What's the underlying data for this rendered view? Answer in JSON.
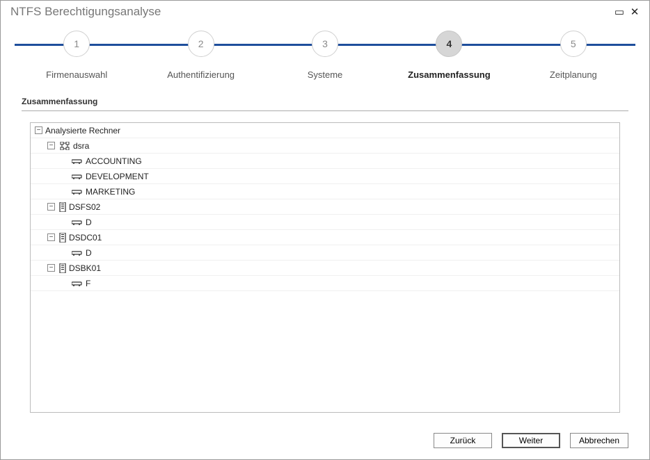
{
  "window": {
    "title": "NTFS Berechtigungsanalyse"
  },
  "stepper": {
    "steps": [
      {
        "num": "1",
        "label": "Firmenauswahl"
      },
      {
        "num": "2",
        "label": "Authentifizierung"
      },
      {
        "num": "3",
        "label": "Systeme"
      },
      {
        "num": "4",
        "label": "Zusammenfassung"
      },
      {
        "num": "5",
        "label": "Zeitplanung"
      }
    ],
    "active_index": 3
  },
  "section_label": "Zusammenfassung",
  "tree": {
    "root_label": "Analysierte Rechner",
    "hosts": [
      {
        "name": "dsra",
        "icon": "net",
        "shares": [
          "ACCOUNTING",
          "DEVELOPMENT",
          "MARKETING"
        ]
      },
      {
        "name": "DSFS02",
        "icon": "server",
        "shares": [
          "D"
        ]
      },
      {
        "name": "DSDC01",
        "icon": "server",
        "shares": [
          "D"
        ]
      },
      {
        "name": "DSBK01",
        "icon": "server",
        "shares": [
          "F"
        ]
      }
    ]
  },
  "buttons": {
    "back": "Zurück",
    "next": "Weiter",
    "cancel": "Abbrechen"
  }
}
